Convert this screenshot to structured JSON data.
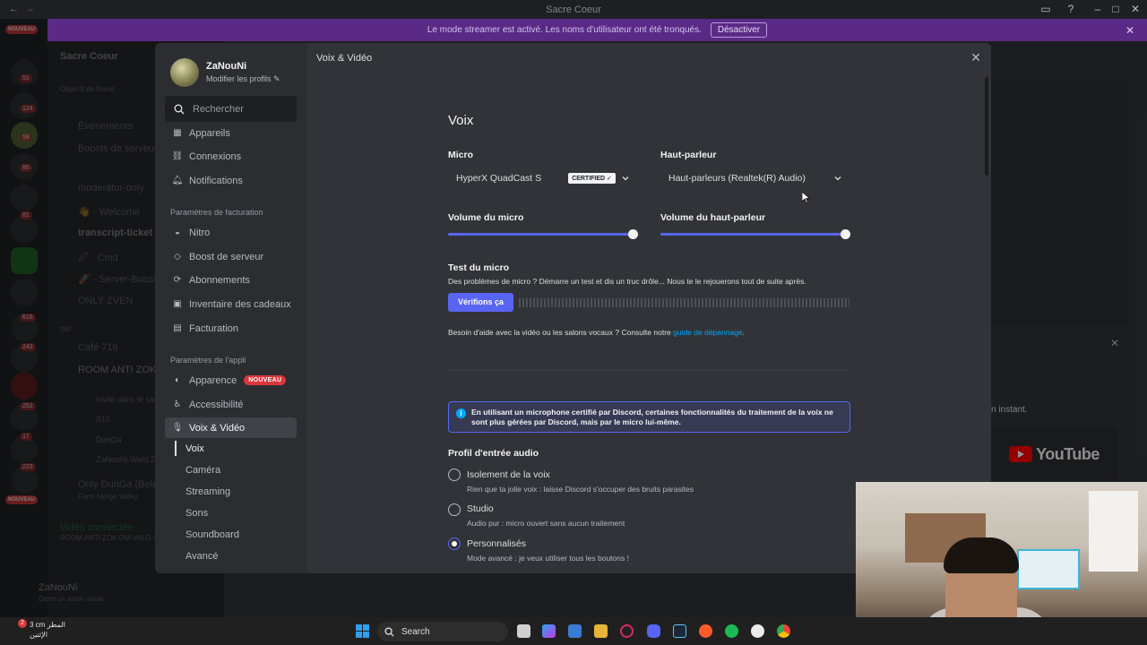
{
  "window": {
    "title": "Sacre Coeur"
  },
  "banner": {
    "text": "Le mode streamer est activé. Les noms d'utilisateur ont été tronqués.",
    "button": "Désactiver"
  },
  "background": {
    "server_name": "Sacre Coeur",
    "boost_goal": "Objectif de Boost",
    "channels": [
      "Événements",
      "Boosts de serveur",
      "moderator-only",
      "👋 · Welcome",
      "transcript-ticket",
      "🖉 · Cmd",
      "🚀 · Server-Boost",
      "ONLY ZVEN",
      "rjel",
      "Café 716",
      "ROOM ANTI ZOK OM VALO",
      "Invité dans le salon",
      "B10",
      "DunGa",
      "ZaNouNi.Weld.Zi...",
      "Only DunGa (Beleh...",
      "Farm Merge Valley"
    ],
    "new_badge": "NOUVEAU",
    "guild_badges": [
      "51",
      "124",
      "59",
      "85",
      "81",
      "616",
      "243",
      "252",
      "17",
      "223"
    ],
    "voice_connected": "Vidéo connectée",
    "voice_channel": "ROOM ANTI ZOK OM VALO / Sacre C...",
    "user_name": "ZaNouNi",
    "user_status": "Dans un salon vocal",
    "right_panel_text": "n instant.",
    "youtube_label": "YouTube"
  },
  "sidebar": {
    "user_name": "ZaNouNi",
    "edit_profiles": "Modifier les profils",
    "search_placeholder": "Rechercher",
    "items_top": [
      {
        "label": "Appareils",
        "icon": "devices-icon"
      },
      {
        "label": "Connexions",
        "icon": "link-icon"
      },
      {
        "label": "Notifications",
        "icon": "bell-icon"
      }
    ],
    "billing_header": "Paramètres de facturation",
    "billing_items": [
      {
        "label": "Nitro",
        "icon": "nitro-icon"
      },
      {
        "label": "Boost de serveur",
        "icon": "boost-icon"
      },
      {
        "label": "Abonnements",
        "icon": "subscriptions-icon"
      },
      {
        "label": "Inventaire des cadeaux",
        "icon": "gift-icon"
      },
      {
        "label": "Facturation",
        "icon": "billing-icon"
      }
    ],
    "app_header": "Paramètres de l'appli",
    "app_items": [
      {
        "label": "Apparence",
        "icon": "appearance-icon",
        "badge": "NOUVEAU"
      },
      {
        "label": "Accessibilité",
        "icon": "accessibility-icon"
      },
      {
        "label": "Voix & Vidéo",
        "icon": "microphone-icon"
      }
    ],
    "sub_items": [
      "Voix",
      "Caméra",
      "Streaming",
      "Sons",
      "Soundboard",
      "Avancé"
    ]
  },
  "content": {
    "breadcrumb": "Voix & Vidéo",
    "title": "Voix",
    "mic_label": "Micro",
    "mic_value": "HyperX QuadCast S",
    "certified": "CERTIFIED ✓",
    "speaker_label": "Haut-parleur",
    "speaker_value": "Haut-parleurs (Realtek(R) Audio)",
    "mic_volume_label": "Volume du micro",
    "speaker_volume_label": "Volume du haut-parleur",
    "mic_volume": 1.0,
    "speaker_volume": 1.0,
    "test_label": "Test du micro",
    "test_desc": "Des problèmes de micro ? Démarre un test et dis un truc drôle... Nous te le rejouerons tout de suite après.",
    "test_button": "Vérifions ça",
    "help_text": "Besoin d'aide avec la vidéo ou les salons vocaux ? Consulte notre ",
    "help_link": "guide de dépannage",
    "help_end": ".",
    "info_text": "En utilisant un microphone certifié par Discord, certaines fonctionnalités du traitement de la voix ne sont plus gérées par Discord, mais par le micro lui-même.",
    "profile_label": "Profil d'entrée audio",
    "profiles": [
      {
        "title": "Isolement de la voix",
        "desc": "Rien que ta jolie voix : laisse Discord s'occuper des bruits parasites",
        "selected": false
      },
      {
        "title": "Studio",
        "desc": "Audio pur : micro ouvert sans aucun traitement",
        "selected": false
      },
      {
        "title": "Personnalisés",
        "desc": "Mode avancé : je veux utiliser tous les boutons !",
        "selected": true
      }
    ],
    "accent": "#5865f2"
  },
  "taskbar": {
    "search": "Search",
    "weather_temp": "3 cm المطر",
    "weather_day": "الإثنين",
    "weather_badge": "2"
  }
}
